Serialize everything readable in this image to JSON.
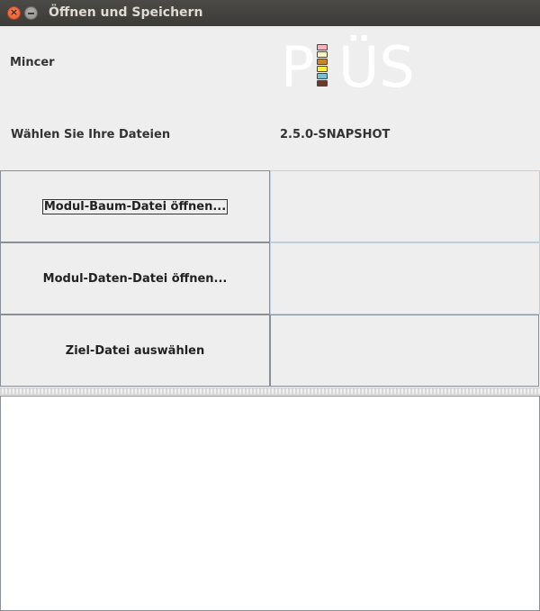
{
  "window": {
    "title": "Öffnen und Speichern"
  },
  "header": {
    "app_name": "Mincer",
    "subtitle": "Wählen Sie Ihre Dateien",
    "version": "2.5.0-SNAPSHOT",
    "logo": {
      "letter_left": "P",
      "letters_right": "ÜS",
      "chip_colors": [
        "#f3b6bf",
        "#fdf7c8",
        "#c7862c",
        "#fdec3a",
        "#7cbfd1",
        "#6a3a2a"
      ]
    }
  },
  "actions": {
    "open_tree": "Modul-Baum-Datei öffnen...",
    "open_data": "Modul-Daten-Datei öffnen...",
    "choose_target": "Ziel-Datei auswählen"
  },
  "status": {
    "tree": "",
    "data": "",
    "target": ""
  },
  "log": {
    "text": ""
  }
}
